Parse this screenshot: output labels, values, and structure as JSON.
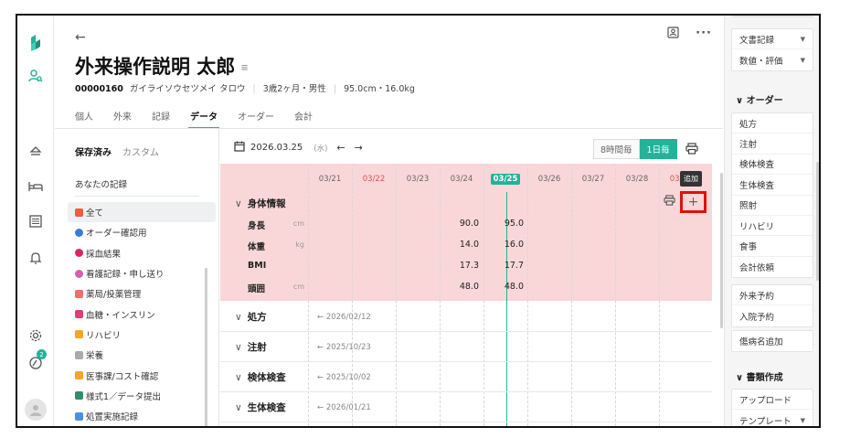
{
  "patient": {
    "name": "外来操作説明 太郎",
    "id": "00000160",
    "kana": "ガイライソウセツメイ タロウ",
    "age_sex": "3歳2ヶ月・男性",
    "body": "95.0cm・16.0kg"
  },
  "nav_tabs": [
    "個人",
    "外来",
    "記録",
    "データ",
    "オーダー",
    "会計"
  ],
  "active_tab": "データ",
  "subtabs": [
    "保存済み",
    "カスタム"
  ],
  "left": {
    "your_records": "あなたの記録",
    "categories": [
      {
        "label": "全て",
        "color": "#e9603a",
        "selected": true
      },
      {
        "label": "オーダー確認用",
        "color": "#3a7bd5"
      },
      {
        "label": "採血結果",
        "color": "#e0245e"
      },
      {
        "label": "看護記録・申し送り",
        "color": "#d45fb0"
      },
      {
        "label": "薬局/投薬管理",
        "color": "#f06e6e"
      },
      {
        "label": "血糖・インスリン",
        "color": "#e04070"
      },
      {
        "label": "リハビリ",
        "color": "#f5a623"
      },
      {
        "label": "栄養",
        "color": "#aaaaaa"
      },
      {
        "label": "医事課/コスト確認",
        "color": "#f5a623"
      },
      {
        "label": "様式1／データ提出",
        "color": "#2d8f6f"
      },
      {
        "label": "処置実施記録",
        "color": "#4a90e2"
      }
    ]
  },
  "toolbar": {
    "date": "2026.03.25",
    "dow": "(水)",
    "prev": "←",
    "next": "→",
    "view_8h": "8時間毎",
    "view_1d": "1日毎"
  },
  "dates": [
    {
      "label": "03/21",
      "red": false
    },
    {
      "label": "03/22",
      "red": true
    },
    {
      "label": "03/23",
      "red": false
    },
    {
      "label": "03/24",
      "red": false
    },
    {
      "label": "03/25",
      "today": true
    },
    {
      "label": "03/26",
      "red": false
    },
    {
      "label": "03/27",
      "red": false
    },
    {
      "label": "03/28",
      "red": false
    },
    {
      "label": "03/29",
      "red": true
    }
  ],
  "tooltip": "追加",
  "body_section": {
    "title": "身体情報",
    "rows": [
      {
        "label": "身長",
        "unit": "cm",
        "v24": "90.0",
        "v25": "95.0"
      },
      {
        "label": "体重",
        "unit": "kg",
        "v24": "14.0",
        "v25": "16.0"
      },
      {
        "label": "BMI",
        "unit": "",
        "v24": "17.3",
        "v25": "17.7"
      },
      {
        "label": "頭囲",
        "unit": "cm",
        "v24": "48.0",
        "v25": "48.0"
      }
    ]
  },
  "sections": [
    {
      "title": "処方",
      "prev": "2026/02/12"
    },
    {
      "title": "注射",
      "prev": "2025/10/23"
    },
    {
      "title": "検体検査",
      "prev": "2025/10/02"
    },
    {
      "title": "生体検査",
      "prev": "2026/01/21"
    }
  ],
  "right": {
    "top": [
      {
        "label": "文書記録",
        "dd": true
      },
      {
        "label": "数値・評価",
        "dd": true
      }
    ],
    "order_head": "オーダー",
    "orders": [
      "処方",
      "注射",
      "検体検査",
      "生体検査",
      "照射",
      "リハビリ",
      "食事",
      "会計依頼"
    ],
    "reserve": [
      "外来予約",
      "入院予約"
    ],
    "disease": "傷病名追加",
    "doc_head": "書類作成",
    "docs": [
      {
        "label": "アップロード",
        "dd": false
      },
      {
        "label": "テンプレート",
        "dd": true
      }
    ]
  },
  "rail": {
    "badge": "2"
  }
}
